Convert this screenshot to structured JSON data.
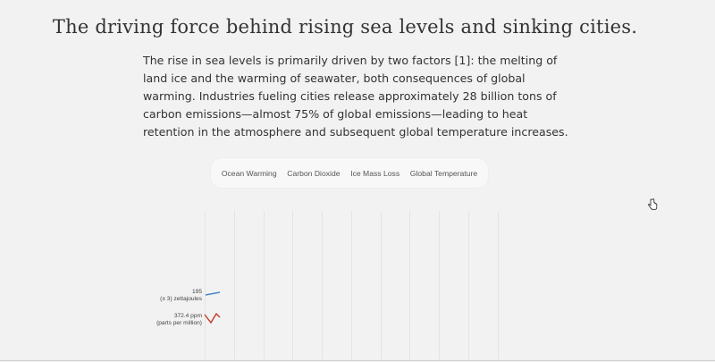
{
  "header": {
    "title": "The driving force behind rising sea levels and sinking cities."
  },
  "intro": {
    "text": "The rise in sea levels is primarily driven by two factors [1]: the melting of land ice and the warming of seawater, both consequences of global warming. Industries fueling cities release approximately 28 billion tons of carbon emissions—almost 75% of global emissions—leading to heat retention in the atmosphere and subsequent global temperature increases."
  },
  "tabs": [
    {
      "label": "Ocean Warming"
    },
    {
      "label": "Carbon Dioxide"
    },
    {
      "label": "Ice Mass Loss"
    },
    {
      "label": "Global Temperature"
    }
  ],
  "chart": {
    "series": [
      {
        "value": "195",
        "unit": "(± 3) zettajoules",
        "color": "#4a86c8"
      },
      {
        "value": "372.4 ppm",
        "unit": "(parts per million)",
        "color": "#c0392b"
      }
    ]
  },
  "icons": {
    "cursor": "hand-pointer-icon"
  }
}
